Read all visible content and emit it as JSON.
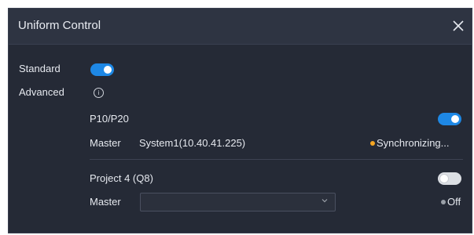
{
  "dialog": {
    "title": "Uniform Control"
  },
  "standard": {
    "label": "Standard",
    "enabled": true
  },
  "advanced": {
    "label": "Advanced",
    "info_icon": "i"
  },
  "groups": [
    {
      "name": "P10/P20",
      "enabled": true,
      "master_label": "Master",
      "master_value": "System1(10.40.41.225)",
      "status_text": "Synchronizing...",
      "status_color": "#f5a623"
    },
    {
      "name": "Project 4 (Q8)",
      "enabled": false,
      "master_label": "Master",
      "master_value": "",
      "status_text": "Off",
      "status_color": "#9aa0a8"
    }
  ],
  "colors": {
    "dialog_bg": "#252a36",
    "header_bg": "#2e3442",
    "accent": "#1e88e5",
    "warning": "#f5a623"
  }
}
